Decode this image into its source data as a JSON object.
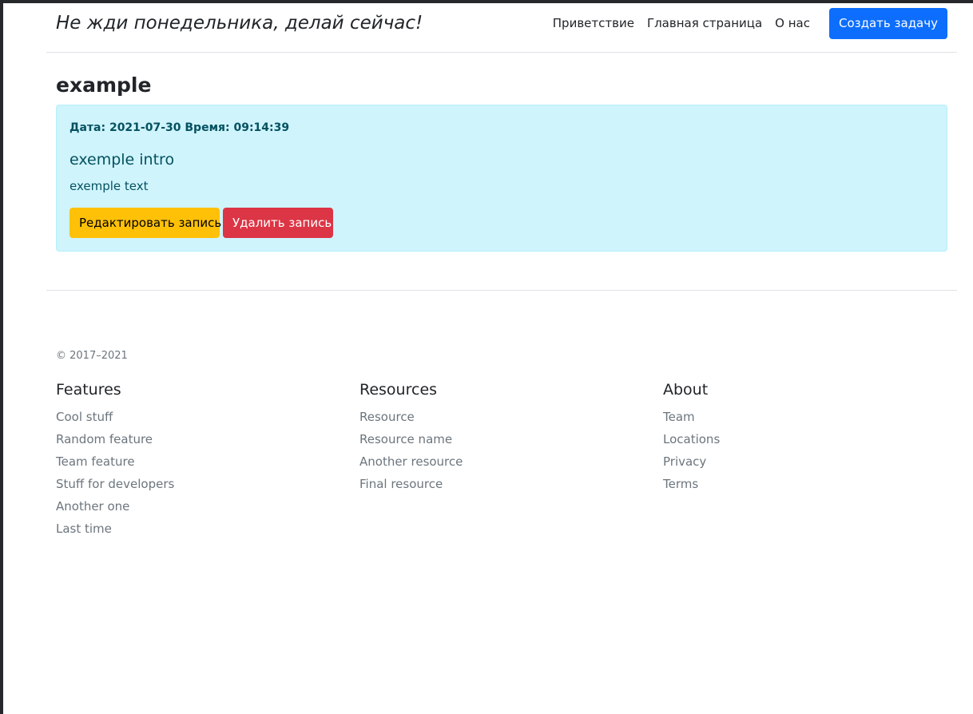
{
  "header": {
    "brand": "Не жди понедельника, делай сейчас!",
    "nav": [
      "Приветствие",
      "Главная страница",
      "О нас"
    ],
    "create_button": "Создать задачу"
  },
  "post": {
    "title": "example",
    "meta": "Дата: 2021-07-30 Время: 09:14:39",
    "intro": "exemple intro",
    "text": "exemple text",
    "edit_button": "Редактировать запись",
    "delete_button": "Удалить запись"
  },
  "footer": {
    "copyright": "© 2017–2021",
    "columns": [
      {
        "title": "Features",
        "links": [
          "Cool stuff",
          "Random feature",
          "Team feature",
          "Stuff for developers",
          "Another one",
          "Last time"
        ]
      },
      {
        "title": "Resources",
        "links": [
          "Resource",
          "Resource name",
          "Another resource",
          "Final resource"
        ]
      },
      {
        "title": "About",
        "links": [
          "Team",
          "Locations",
          "Privacy",
          "Terms"
        ]
      }
    ]
  },
  "colors": {
    "primary": "#0d6efd",
    "warning": "#ffc107",
    "danger": "#dc3545",
    "info_bg": "#cff4fc",
    "info_text": "#055160",
    "muted": "#6c757d"
  }
}
